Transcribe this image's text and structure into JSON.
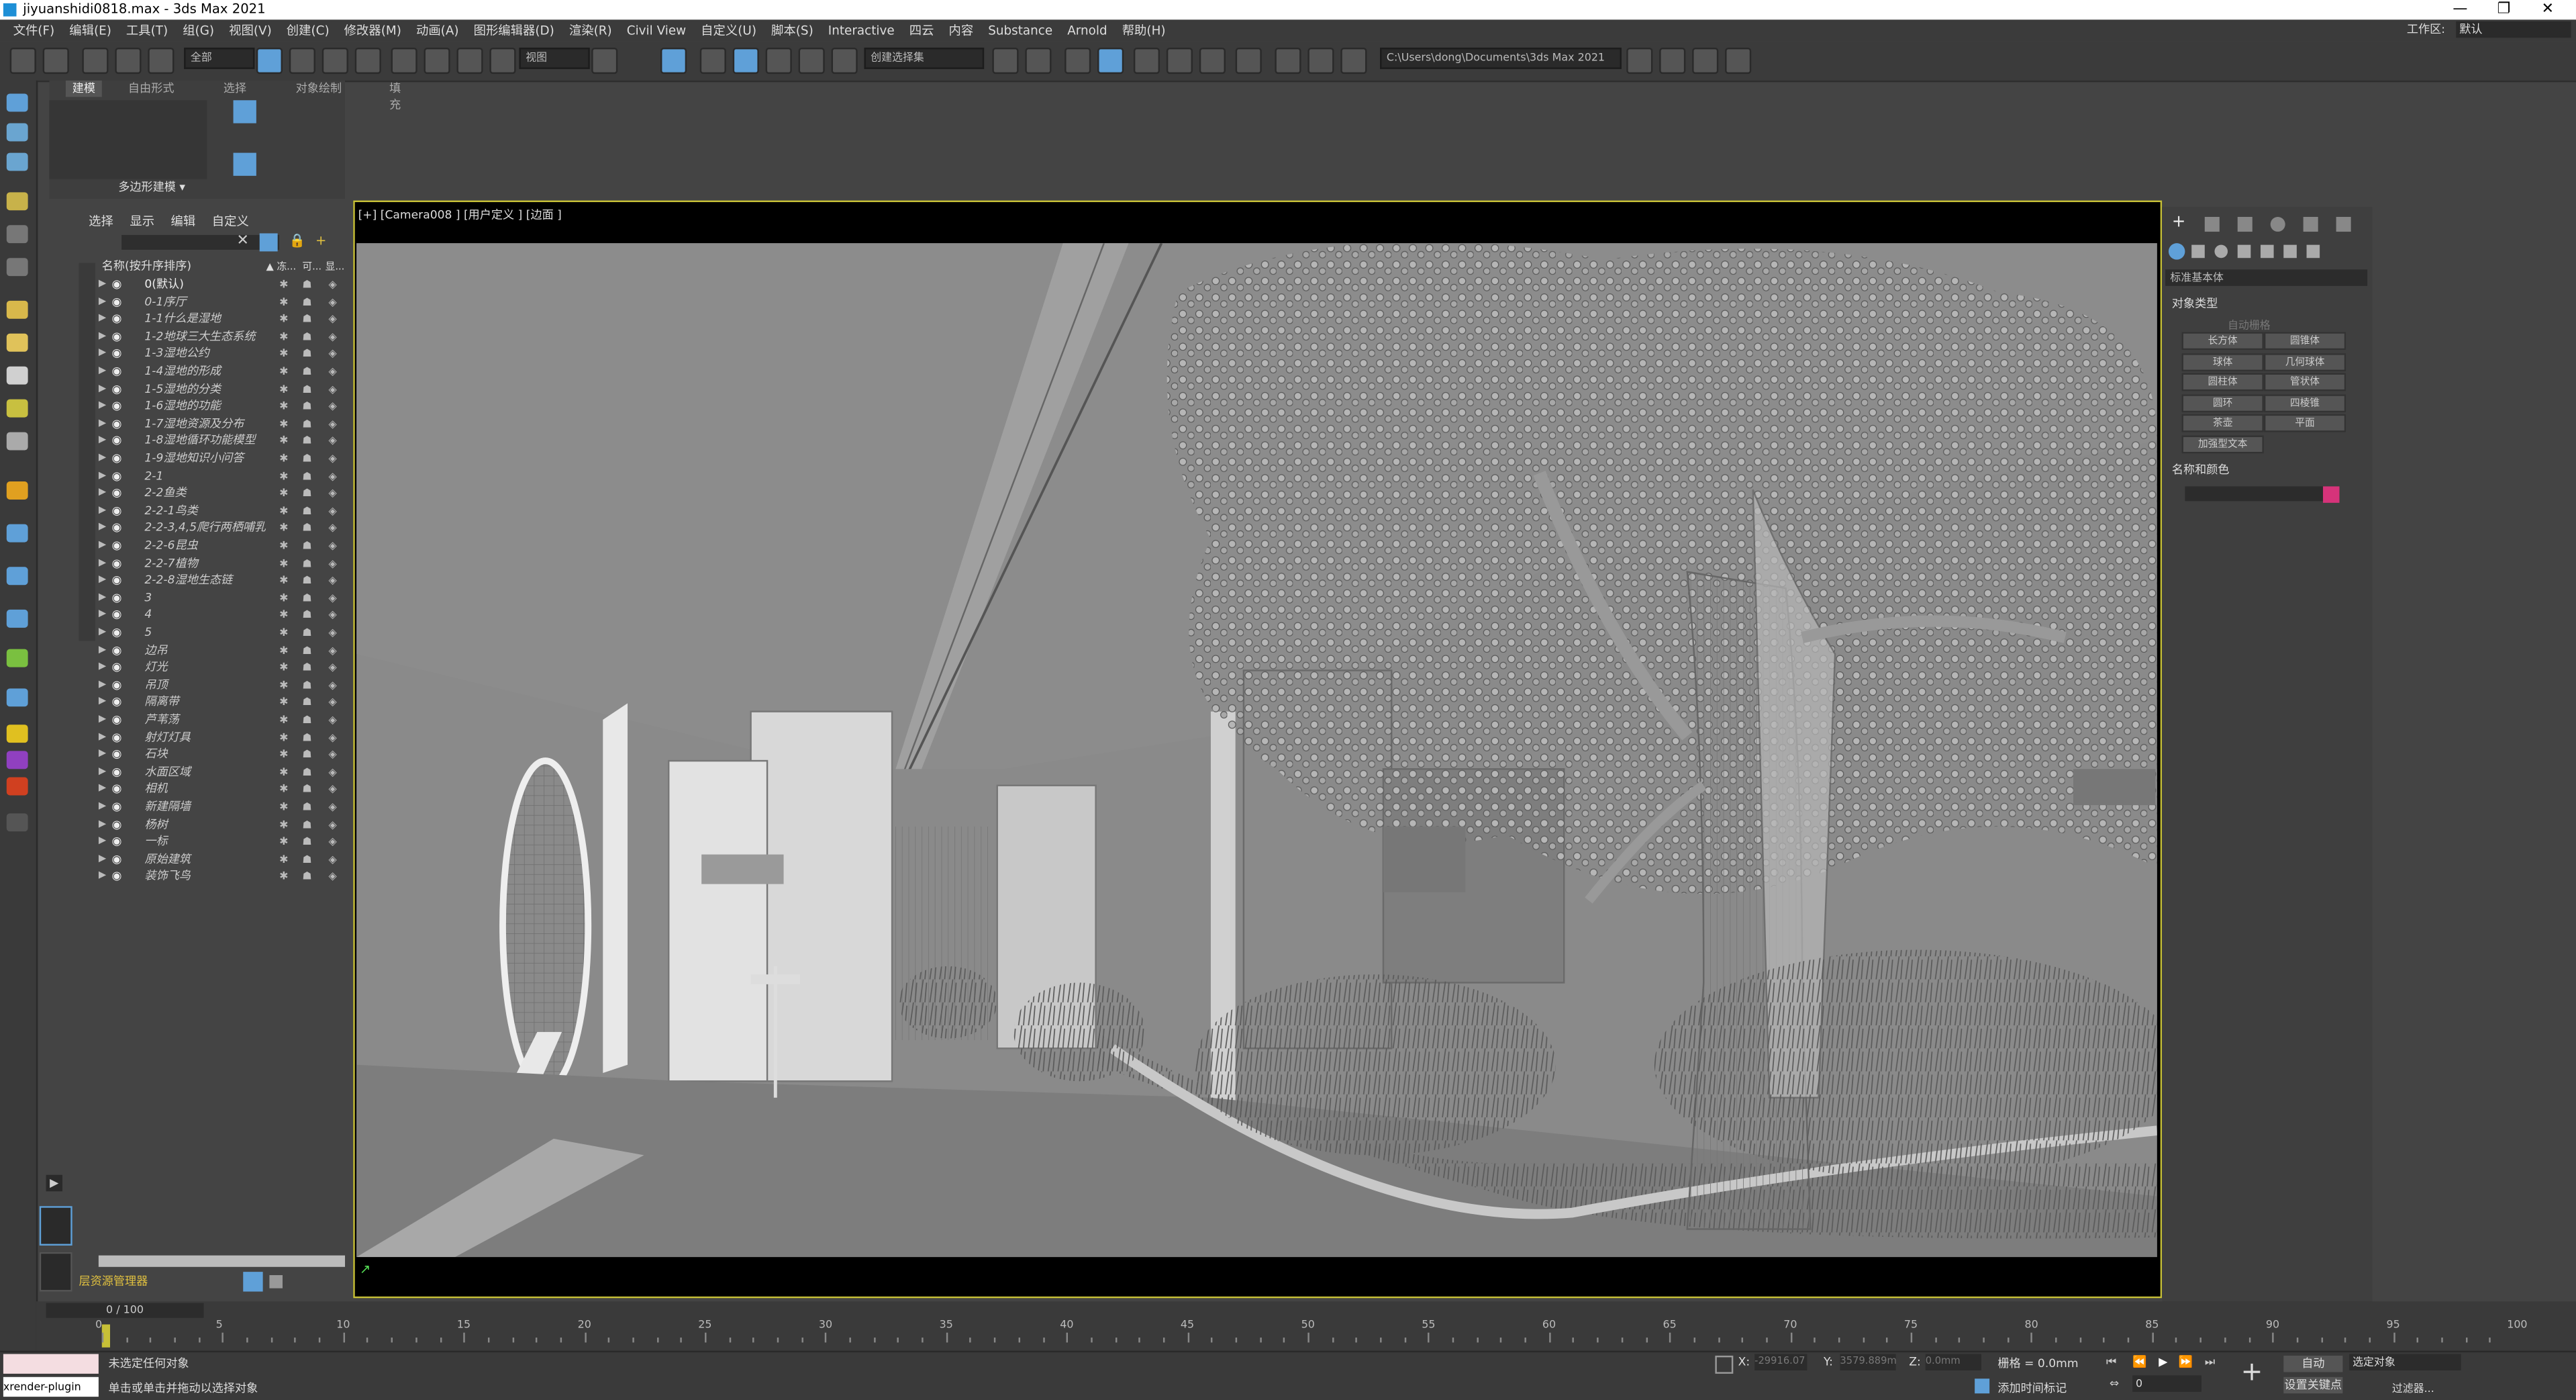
{
  "window": {
    "title": "jiyuanshidi0818.max - 3ds Max 2021",
    "controls": [
      "—",
      "❐",
      "✕"
    ]
  },
  "menu": [
    "文件(F)",
    "编辑(E)",
    "工具(T)",
    "组(G)",
    "视图(V)",
    "创建(C)",
    "修改器(M)",
    "动画(A)",
    "图形编辑器(D)",
    "渲染(R)",
    "Civil View",
    "自定义(U)",
    "脚本(S)",
    "Interactive",
    "四云",
    "内容",
    "Substance",
    "Arnold",
    "帮助(H)"
  ],
  "workspace": {
    "label": "工作区:",
    "value": "默认"
  },
  "toolbar": {
    "filter": "全部",
    "view": "视图",
    "selection_set": "创建选择集",
    "path": "C:\\Users\\dong\\Documents\\3ds Max 2021"
  },
  "ribbon": {
    "tabs": [
      "建模",
      "自由形式",
      "选择",
      "对象绘制",
      "填充"
    ],
    "panel_label": "多边形建模 ▾"
  },
  "scene_explorer": {
    "menu": [
      "选择",
      "显示",
      "编辑",
      "自定义"
    ],
    "header": {
      "name": "名称(按升序排序)",
      "c1": "▲ 冻...",
      "c2": "可...",
      "c3": "显..."
    },
    "rows": [
      "0(默认)",
      "0-1序厅",
      "1-1什么是湿地",
      "1-2地球三大生态系统",
      "1-3湿地公约",
      "1-4湿地的形成",
      "1-5湿地的分类",
      "1-6湿地的功能",
      "1-7湿地资源及分布",
      "1-8湿地循环功能模型",
      "1-9湿地知识小问答",
      "2-1",
      "2-2鱼类",
      "2-2-1鸟类",
      "2-2-3,4,5爬行两栖哺乳",
      "2-2-6昆虫",
      "2-2-7植物",
      "2-2-8湿地生态链",
      "3",
      "4",
      "5",
      "边吊",
      "灯光",
      "吊顶",
      "隔离带",
      "芦苇荡",
      "射灯灯具",
      "石块",
      "水面区域",
      "相机",
      "新建隔墙",
      "杨树",
      "一标",
      "原始建筑",
      "装饰飞鸟"
    ],
    "footer": "层资源管理器"
  },
  "viewport": {
    "label": "[+] [Camera008 ] [用户定义 ] [边面 ]"
  },
  "command_panel": {
    "dropdown": "标准基本体",
    "section1": "对象类型",
    "autogrid": "自动栅格",
    "buttons": [
      "长方体",
      "圆锥体",
      "球体",
      "几何球体",
      "圆柱体",
      "管状体",
      "圆环",
      "四棱锥",
      "茶壶",
      "平面",
      "加强型文本"
    ],
    "section2": "名称和颜色",
    "swatch_color": "#d6337a"
  },
  "timeline": {
    "frame_display": "0 / 100",
    "ticks": [
      "0",
      "5",
      "10",
      "15",
      "20",
      "25",
      "30",
      "35",
      "40",
      "45",
      "50",
      "55",
      "60",
      "65",
      "70",
      "75",
      "80",
      "85",
      "90",
      "95",
      "100"
    ]
  },
  "status": {
    "script_label": "xrender-plugin",
    "line1": "未选定任何对象",
    "line2": "单击或单击并拖动以选择对象",
    "x_label": "X:",
    "x_value": "-29916.07",
    "y_label": "Y:",
    "y_value": "3579.889m",
    "z_label": "Z:",
    "z_value": "0.0mm",
    "grid": "栅格 = 0.0mm",
    "add_time_tag": "添加时间标记",
    "auto": "自动",
    "set_key": "设置关键点",
    "selected": "选定对象",
    "filters": "过滤器...",
    "frame": "0"
  },
  "colors": {
    "accent": "#5fa0d8",
    "viewport_border": "#c7c037"
  }
}
